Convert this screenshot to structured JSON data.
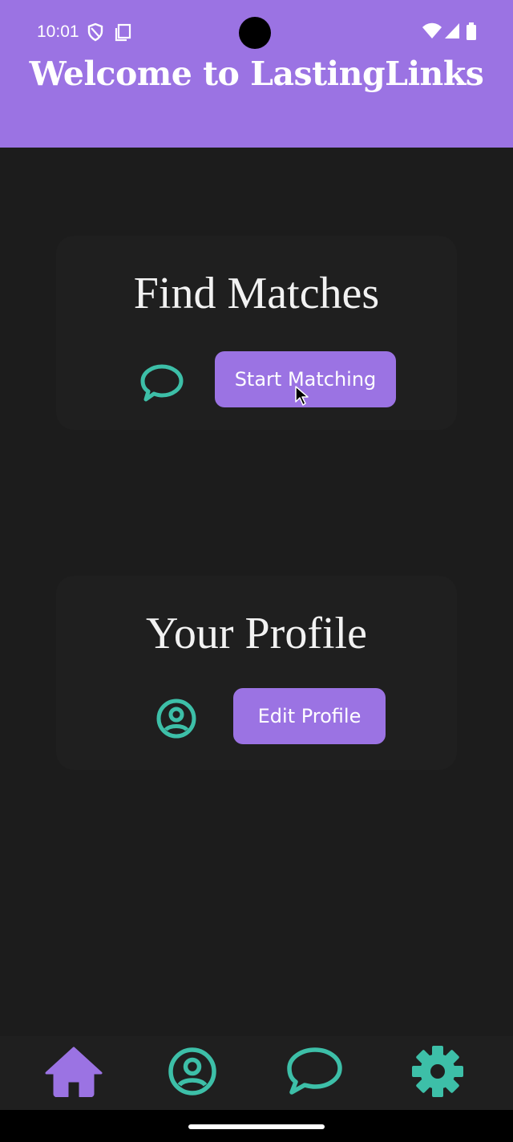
{
  "status_bar": {
    "time": "10:01",
    "icons": [
      "vpn-shield-icon",
      "screenshot-icon",
      "wifi-icon",
      "signal-icon",
      "battery-icon"
    ]
  },
  "header": {
    "title": "Welcome to LastingLinks"
  },
  "cards": [
    {
      "title": "Find Matches",
      "icon": "chat-bubble-icon",
      "button_label": "Start Matching"
    },
    {
      "title": "Your Profile",
      "icon": "account-circle-icon",
      "button_label": "Edit Profile"
    }
  ],
  "bottom_nav": {
    "items": [
      {
        "icon": "home-icon",
        "active": true
      },
      {
        "icon": "account-circle-icon",
        "active": false
      },
      {
        "icon": "chat-bubble-icon",
        "active": false
      },
      {
        "icon": "settings-icon",
        "active": false
      }
    ]
  },
  "colors": {
    "primary": "#9b73e3",
    "accent": "#3dbfa8",
    "background": "#1c1c1c",
    "card": "#1f1f1f"
  }
}
